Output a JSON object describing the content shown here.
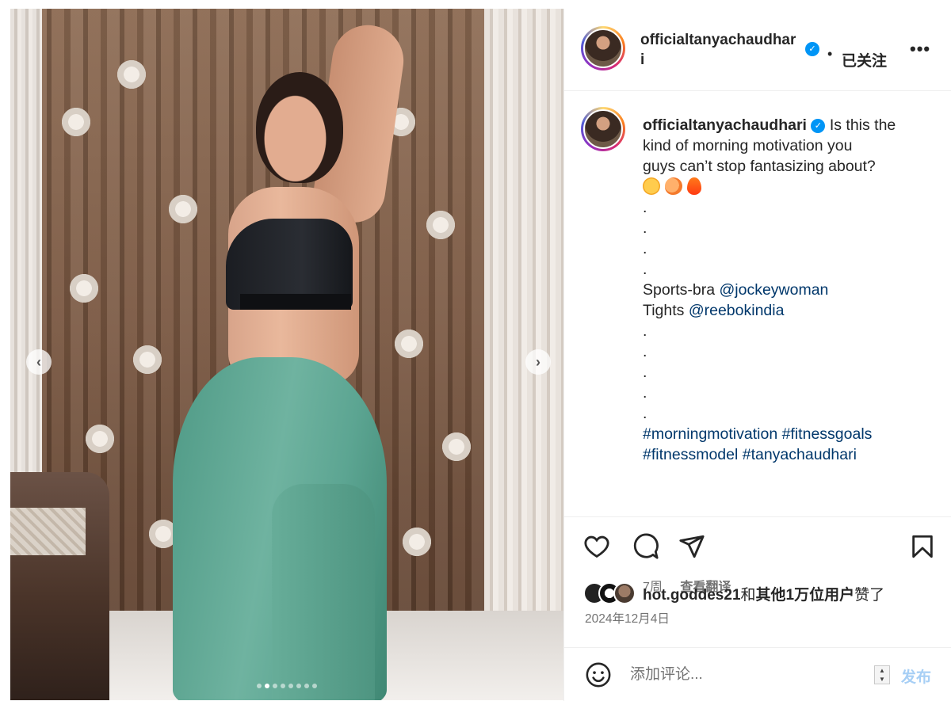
{
  "post": {
    "username": "officialtanyachaudhari",
    "header_username": "officialtanyachaudhari",
    "verified_mark": "✓",
    "separator": "•",
    "follow_status": "已关注",
    "more_label": "•••"
  },
  "media": {
    "prev_label": "‹",
    "next_label": "›",
    "dots_count": 8,
    "active_dot": 1
  },
  "caption": {
    "username": "officialtanyachaudhari",
    "text_line1": "Is this the",
    "text_line2": "kind of morning motivation you",
    "text_line3": "guys can’t stop fantasizing about?",
    "emojis": [
      "wink-emoji",
      "peach-emoji",
      "fire-emoji"
    ],
    "dot_lines_1": [
      ".",
      ".",
      ".",
      "."
    ],
    "sports_bra_label": "Sports-bra",
    "sports_bra_link": "@jockeywoman",
    "tights_label": "Tights",
    "tights_link": "@reebokindia",
    "dot_lines_2": [
      ".",
      ".",
      ".",
      ".",
      "."
    ],
    "hashtags_line1": "#morningmotivation #fitnessgoals",
    "hashtags_line2": "#fitnessmodel #tanyachaudhari",
    "time_ago": "7周",
    "translate": "查看翻译"
  },
  "actions": {
    "like_icon": "heart-icon",
    "comment_icon": "comment-icon",
    "share_icon": "send-icon",
    "save_icon": "bookmark-icon"
  },
  "likes": {
    "liker": "hot.goddes21",
    "connector": "和",
    "others": "其他1万位用户",
    "suffix": "赞了"
  },
  "date": "2024年12月4日",
  "comment": {
    "placeholder": "添加评论...",
    "spinner_up": "▲",
    "spinner_down": "▼",
    "post_label": "发布"
  },
  "colors": {
    "link": "#00376b",
    "verified": "#0095f6",
    "post_disabled": "#a7cff5",
    "muted": "#737373"
  }
}
